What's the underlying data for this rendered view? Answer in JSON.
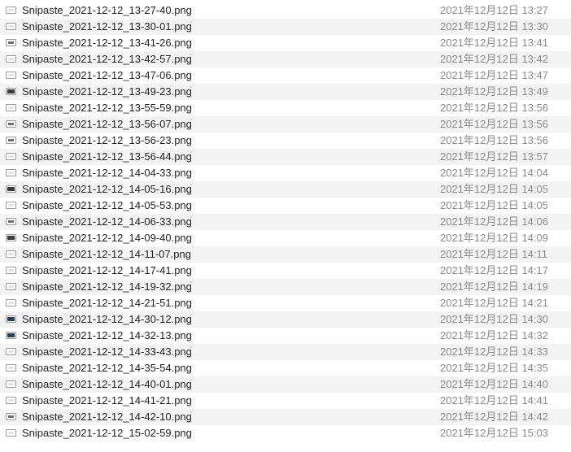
{
  "files": [
    {
      "name": "Snipaste_2021-12-12_13-27-40.png",
      "date": "2021年12月12日 13:27",
      "icon": "light"
    },
    {
      "name": "Snipaste_2021-12-12_13-30-01.png",
      "date": "2021年12月12日 13:30",
      "icon": "light"
    },
    {
      "name": "Snipaste_2021-12-12_13-41-26.png",
      "date": "2021年12月12日 13:41",
      "icon": "mid"
    },
    {
      "name": "Snipaste_2021-12-12_13-42-57.png",
      "date": "2021年12月12日 13:42",
      "icon": "light"
    },
    {
      "name": "Snipaste_2021-12-12_13-47-06.png",
      "date": "2021年12月12日 13:47",
      "icon": "light"
    },
    {
      "name": "Snipaste_2021-12-12_13-49-23.png",
      "date": "2021年12月12日 13:49",
      "icon": "dark"
    },
    {
      "name": "Snipaste_2021-12-12_13-55-59.png",
      "date": "2021年12月12日 13:56",
      "icon": "light"
    },
    {
      "name": "Snipaste_2021-12-12_13-56-07.png",
      "date": "2021年12月12日 13:56",
      "icon": "mid"
    },
    {
      "name": "Snipaste_2021-12-12_13-56-23.png",
      "date": "2021年12月12日 13:56",
      "icon": "mid"
    },
    {
      "name": "Snipaste_2021-12-12_13-56-44.png",
      "date": "2021年12月12日 13:57",
      "icon": "light"
    },
    {
      "name": "Snipaste_2021-12-12_14-04-33.png",
      "date": "2021年12月12日 14:04",
      "icon": "light"
    },
    {
      "name": "Snipaste_2021-12-12_14-05-16.png",
      "date": "2021年12月12日 14:05",
      "icon": "dark"
    },
    {
      "name": "Snipaste_2021-12-12_14-05-53.png",
      "date": "2021年12月12日 14:05",
      "icon": "light"
    },
    {
      "name": "Snipaste_2021-12-12_14-06-33.png",
      "date": "2021年12月12日 14:06",
      "icon": "mid"
    },
    {
      "name": "Snipaste_2021-12-12_14-09-40.png",
      "date": "2021年12月12日 14:09",
      "icon": "dark"
    },
    {
      "name": "Snipaste_2021-12-12_14-11-07.png",
      "date": "2021年12月12日 14:11",
      "icon": "light"
    },
    {
      "name": "Snipaste_2021-12-12_14-17-41.png",
      "date": "2021年12月12日 14:17",
      "icon": "light"
    },
    {
      "name": "Snipaste_2021-12-12_14-19-32.png",
      "date": "2021年12月12日 14:19",
      "icon": "light"
    },
    {
      "name": "Snipaste_2021-12-12_14-21-51.png",
      "date": "2021年12月12日 14:21",
      "icon": "light"
    },
    {
      "name": "Snipaste_2021-12-12_14-30-12.png",
      "date": "2021年12月12日 14:30",
      "icon": "blue"
    },
    {
      "name": "Snipaste_2021-12-12_14-32-13.png",
      "date": "2021年12月12日 14:32",
      "icon": "blue"
    },
    {
      "name": "Snipaste_2021-12-12_14-33-43.png",
      "date": "2021年12月12日 14:33",
      "icon": "light"
    },
    {
      "name": "Snipaste_2021-12-12_14-35-54.png",
      "date": "2021年12月12日 14:35",
      "icon": "light"
    },
    {
      "name": "Snipaste_2021-12-12_14-40-01.png",
      "date": "2021年12月12日 14:40",
      "icon": "light"
    },
    {
      "name": "Snipaste_2021-12-12_14-41-21.png",
      "date": "2021年12月12日 14:41",
      "icon": "light"
    },
    {
      "name": "Snipaste_2021-12-12_14-42-10.png",
      "date": "2021年12月12日 14:42",
      "icon": "mid"
    },
    {
      "name": "Snipaste_2021-12-12_15-02-59.png",
      "date": "2021年12月12日 15:03",
      "icon": "light"
    }
  ]
}
